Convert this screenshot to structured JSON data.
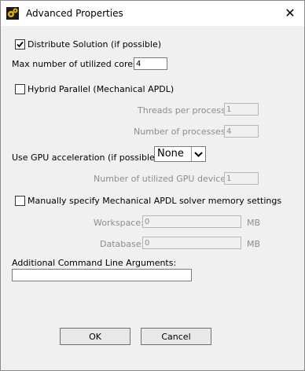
{
  "window": {
    "title": "Advanced Properties",
    "close_glyph": "✕"
  },
  "distribute": {
    "label": "Distribute Solution (if possible)",
    "checked": true
  },
  "max_cores": {
    "label": "Max number of utilized cores:",
    "value": "4"
  },
  "hybrid": {
    "label": "Hybrid Parallel (Mechanical APDL)",
    "checked": false
  },
  "threads": {
    "label": "Threads per process:",
    "value": "1"
  },
  "processes": {
    "label": "Number of processes:",
    "value": "4"
  },
  "gpu": {
    "label": "Use GPU acceleration (if possible)",
    "selected": "None"
  },
  "gpu_devices": {
    "label": "Number of utilized GPU devices:",
    "value": "1"
  },
  "memory": {
    "label": "Manually specify Mechanical APDL solver memory settings",
    "checked": false
  },
  "workspace": {
    "label": "Workspace:",
    "value": "0",
    "unit": "MB"
  },
  "database": {
    "label": "Database:",
    "value": "0",
    "unit": "MB"
  },
  "args": {
    "label": "Additional Command Line Arguments:",
    "value": ""
  },
  "buttons": {
    "ok": "OK",
    "cancel": "Cancel"
  },
  "colors": {
    "icon_accent": "#e8b800",
    "disabled_text": "#8d8d8d"
  }
}
